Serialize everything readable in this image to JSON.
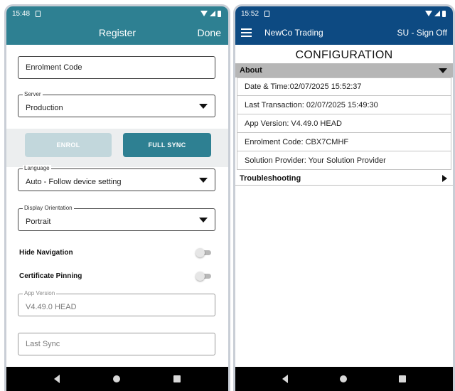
{
  "left": {
    "status": {
      "time": "15:48"
    },
    "header": {
      "title": "Register",
      "done": "Done"
    },
    "enrolment_code": {
      "placeholder": "Enrolment Code"
    },
    "server": {
      "legend": "Server",
      "value": "Production"
    },
    "buttons": {
      "enrol": "ENROL",
      "full_sync": "FULL SYNC"
    },
    "language": {
      "legend": "Language",
      "value": "Auto - Follow device setting"
    },
    "orientation": {
      "legend": "Display Orientation",
      "value": "Portrait"
    },
    "hide_navigation": {
      "label": "Hide Navigation",
      "enabled": false
    },
    "certificate_pinning": {
      "label": "Certificate Pinning",
      "enabled": false
    },
    "app_version": {
      "legend": "App Version",
      "value": "V4.49.0 HEAD"
    },
    "last_sync": {
      "placeholder": "Last Sync"
    }
  },
  "right": {
    "status": {
      "time": "15:52"
    },
    "header": {
      "app_name": "NewCo Trading",
      "sign_off": "SU - Sign Off"
    },
    "title": "CONFIGURATION",
    "sections": {
      "about": {
        "label": "About",
        "rows": [
          "Date & Time:02/07/2025 15:52:37",
          "Last Transaction: 02/07/2025 15:49:30",
          "App Version: V4.49.0 HEAD",
          "Enrolment Code: CBX7CMHF",
          "Solution Provider: Your Solution Provider"
        ]
      },
      "troubleshooting": {
        "label": "Troubleshooting"
      }
    }
  },
  "colors": {
    "register_header": "#2e8092",
    "config_header": "#0d4a82",
    "enrol_disabled": "#c2d7dc",
    "section_header": "#b6b6b6"
  },
  "icons": {
    "status": [
      "sim-icon",
      "wifi-icon",
      "signal-icon",
      "battery-icon"
    ],
    "nav": [
      "back-icon",
      "home-icon",
      "recents-icon"
    ],
    "menu": "hamburger-menu-icon"
  }
}
